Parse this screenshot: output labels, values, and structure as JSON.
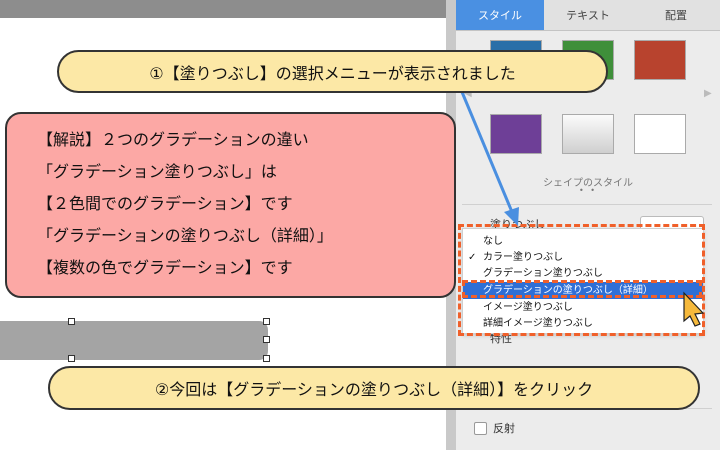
{
  "inspector": {
    "tabs": [
      {
        "label": "スタイル",
        "active": true
      },
      {
        "label": "テキスト",
        "active": false
      },
      {
        "label": "配置",
        "active": false
      }
    ],
    "shape_styles_caption": "シェイプのスタイル",
    "page_dots": "• •",
    "fill_label": "塗りつぶし",
    "reflection_label": "反射",
    "partial_label": "特性"
  },
  "fill_menu": {
    "items": [
      {
        "label": "なし",
        "checked": false,
        "selected": false
      },
      {
        "label": "カラー塗りつぶし",
        "checked": true,
        "selected": false
      },
      {
        "label": "グラデーション塗りつぶし",
        "checked": false,
        "selected": false
      },
      {
        "label": "グラデーションの塗りつぶし（詳細）",
        "checked": false,
        "selected": true
      },
      {
        "label": "イメージ塗りつぶし",
        "checked": false,
        "selected": false
      },
      {
        "label": "詳細イメージ塗りつぶし",
        "checked": false,
        "selected": false
      }
    ],
    "checkmark": "✓"
  },
  "swatch_colors": [
    "#2a6fa8",
    "#3f8f3a",
    "#b8432e",
    "#6e3f97",
    "#e6e6e6",
    "#ffffff"
  ],
  "callouts": {
    "step1": "①【塗りつぶし】の選択メニューが表示されました",
    "step2": "②今回は【グラデーションの塗りつぶし（詳細）】をクリック",
    "explanation": [
      "【解説】２つのグラデーションの違い",
      "「グラデーション塗りつぶし」は",
      "【２色間でのグラデーション】です",
      "「グラデーションの塗りつぶし（詳細）」",
      "【複数の色でグラデーション】です"
    ]
  },
  "colors": {
    "accent": "#4a90e2",
    "menu_highlight": "#2f6fd6",
    "annotation_orange": "#f0602a",
    "callout_yellow": "#fce8a6",
    "callout_pink": "#fca8a5",
    "arrow_blue": "#4a8fe0"
  }
}
